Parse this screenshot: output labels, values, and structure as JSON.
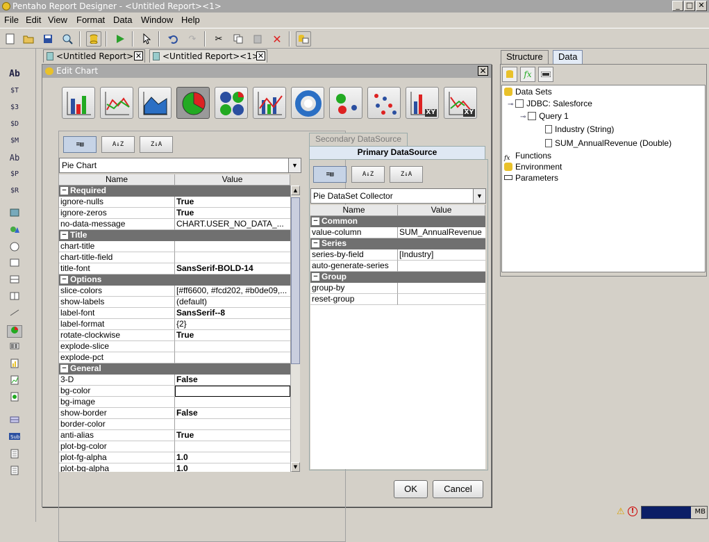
{
  "window": {
    "title": "Pentaho Report Designer - <Untitled Report><1>",
    "min": "_",
    "max": "□",
    "close": "✕"
  },
  "menu": [
    "File",
    "Edit",
    "View",
    "Format",
    "Data",
    "Window",
    "Help"
  ],
  "doc_tabs": [
    "<Untitled Report>",
    "<Untitled Report><1>"
  ],
  "palette": [
    "Ab",
    "$T",
    "$3",
    "$D",
    "$M",
    "Ab",
    "$P",
    "$R"
  ],
  "right_panel": {
    "tabs": [
      "Structure",
      "Data"
    ],
    "tree": {
      "data_sets": "Data Sets",
      "connection": "JDBC: Salesforce",
      "query": "Query 1",
      "field1": "Industry (String)",
      "field2": "SUM_AnnualRevenue (Double)",
      "functions": "Functions",
      "environment": "Environment",
      "parameters": "Parameters"
    }
  },
  "dialog": {
    "title": "Edit Chart",
    "close": "✕",
    "chart_types": [
      "bar",
      "line",
      "area",
      "pie",
      "multi-pie",
      "bar-line",
      "ring",
      "bubble",
      "scatter",
      "xy-bar",
      "xy-line"
    ],
    "selected_chart_type": "pie",
    "left": {
      "selector": "Pie Chart",
      "headers": {
        "name": "Name",
        "value": "Value"
      },
      "groups": [
        {
          "label": "Required",
          "rows": [
            {
              "name": "ignore-nulls",
              "value": "True"
            },
            {
              "name": "ignore-zeros",
              "value": "True"
            },
            {
              "name": "no-data-message",
              "value": "CHART.USER_NO_DATA_..."
            }
          ]
        },
        {
          "label": "Title",
          "rows": [
            {
              "name": "chart-title",
              "value": ""
            },
            {
              "name": "chart-title-field",
              "value": ""
            },
            {
              "name": "title-font",
              "value": "SansSerif-BOLD-14"
            }
          ]
        },
        {
          "label": "Options",
          "rows": [
            {
              "name": "slice-colors",
              "value": "[#ff6600, #fcd202, #b0de09,..."
            },
            {
              "name": "show-labels",
              "value": "(default)"
            },
            {
              "name": "label-font",
              "value": "SansSerif--8"
            },
            {
              "name": "label-format",
              "value": "{2}"
            },
            {
              "name": "rotate-clockwise",
              "value": "True"
            },
            {
              "name": "explode-slice",
              "value": ""
            },
            {
              "name": "explode-pct",
              "value": ""
            }
          ]
        },
        {
          "label": "General",
          "rows": [
            {
              "name": "3-D",
              "value": "False"
            },
            {
              "name": "bg-color",
              "value": ""
            },
            {
              "name": "bg-image",
              "value": ""
            },
            {
              "name": "show-border",
              "value": "False"
            },
            {
              "name": "border-color",
              "value": ""
            },
            {
              "name": "anti-alias",
              "value": "True"
            },
            {
              "name": "plot-bg-color",
              "value": ""
            },
            {
              "name": "plot-fg-alpha",
              "value": "1.0"
            },
            {
              "name": "plot-bg-alpha",
              "value": "1.0"
            }
          ]
        }
      ]
    },
    "right": {
      "tab_secondary": "Secondary DataSource",
      "tab_primary": "Primary DataSource",
      "selector": "Pie DataSet Collector",
      "headers": {
        "name": "Name",
        "value": "Value"
      },
      "groups": [
        {
          "label": "Common",
          "rows": [
            {
              "name": "value-column",
              "value": "SUM_AnnualRevenue"
            }
          ]
        },
        {
          "label": "Series",
          "rows": [
            {
              "name": "series-by-field",
              "value": "[Industry]"
            },
            {
              "name": "auto-generate-series",
              "value": ""
            }
          ]
        },
        {
          "label": "Group",
          "rows": [
            {
              "name": "group-by",
              "value": ""
            },
            {
              "name": "reset-group",
              "value": ""
            }
          ]
        }
      ]
    },
    "ok": "OK",
    "cancel": "Cancel"
  },
  "status": {
    "memory": "MB",
    "memory_used_fraction": 0.75
  }
}
